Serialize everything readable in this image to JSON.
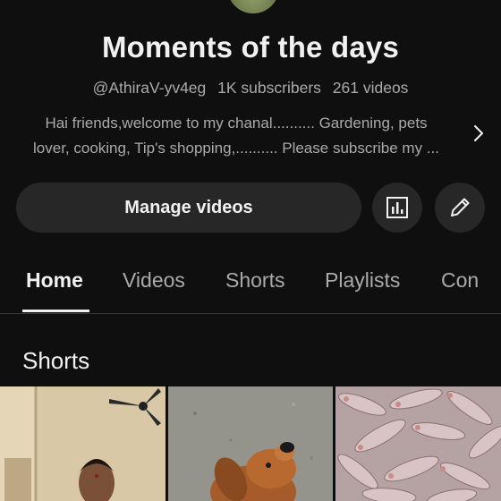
{
  "channel": {
    "title": "Moments of the days",
    "handle": "@AthiraV-yv4eg",
    "subscribers": "1K subscribers",
    "videos": "261 videos",
    "description_line1": "Hai friends,welcome to my chanal.......... Gardening, pets",
    "description_line2": "lover, cooking, Tip's shopping,.......... Please subscribe my ..."
  },
  "actions": {
    "manage_label": "Manage videos"
  },
  "tabs": [
    {
      "label": "Home",
      "active": true
    },
    {
      "label": "Videos",
      "active": false
    },
    {
      "label": "Shorts",
      "active": false
    },
    {
      "label": "Playlists",
      "active": false
    },
    {
      "label": "Con",
      "active": false
    }
  ],
  "sections": {
    "shorts_title": "Shorts"
  },
  "icons": {
    "analytics": "bar-chart-icon",
    "edit": "pencil-icon",
    "more": "chevron-right-icon"
  },
  "colors": {
    "background": "#0f0f0f",
    "button": "#272727",
    "text_primary": "#f1f1f1",
    "text_secondary": "#aaaaaa"
  }
}
